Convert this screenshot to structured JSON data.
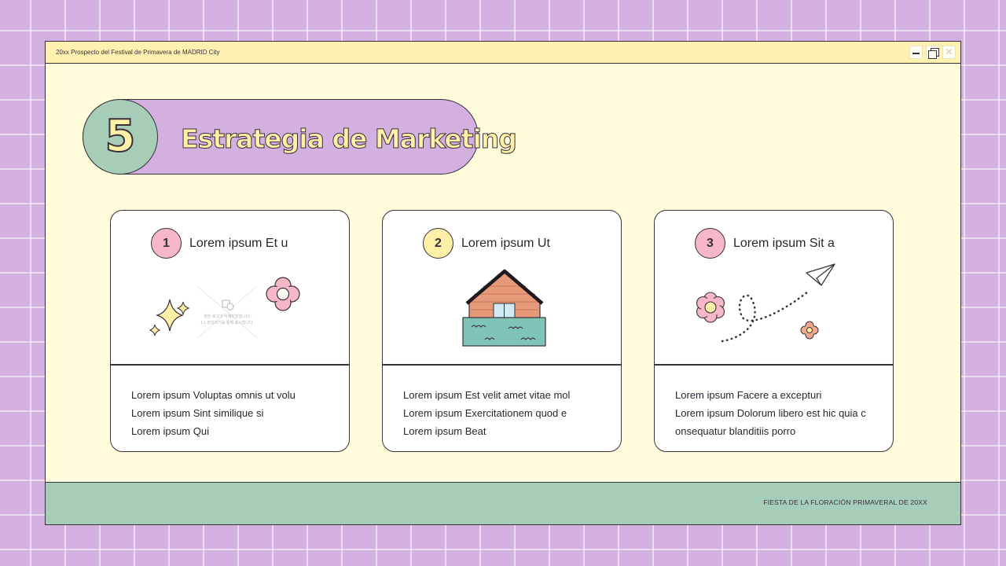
{
  "window": {
    "title": "20xx Prospecto del Festival de Primavera de MADRID City",
    "controls": [
      "minimize-icon",
      "restore-icon",
      "close-icon"
    ],
    "close_glyph": "✕"
  },
  "heading": {
    "number": "5",
    "title": "Estrategia de Marketing"
  },
  "cards": [
    {
      "badge": "1",
      "title": "Lorem ipsum Et u",
      "icons": [
        "sparkle-icon",
        "image-placeholder-icon",
        "flower-icon"
      ],
      "placeholder_line1": "편한 로고가 삭제되었습니다.",
      "placeholder_line2": "1:1 편의리기를 통해 표시합니다.",
      "lines": [
        "Lorem ipsum Voluptas omnis ut volu",
        "Lorem ipsum Sint similique si",
        "Lorem ipsum Qui"
      ]
    },
    {
      "badge": "2",
      "title": "Lorem ipsum Ut",
      "icons": [
        "house-icon"
      ],
      "lines": [
        "Lorem ipsum Est velit amet vitae mol",
        "Lorem ipsum Exercitationem quod e",
        "Lorem ipsum Beat"
      ]
    },
    {
      "badge": "3",
      "title": "Lorem ipsum Sit a",
      "icons": [
        "flower-icon",
        "paper-plane-icon",
        "flower-icon"
      ],
      "lines": [
        "Lorem ipsum Facere a excepturi",
        "Lorem ipsum Dolorum libero est hic quia c",
        "onsequatur blanditiis porro"
      ]
    }
  ],
  "footer": {
    "text": "FIESTA DE LA FLORACIÓN PRIMAVERAL DE 20XX"
  },
  "colors": {
    "background": "#d3b0e0",
    "grid_lines": "#ffffff",
    "window_body": "#fffcdc",
    "title_bar": "#fff2b0",
    "number_circle": "#a6cdb8",
    "footer": "#a6cdb8",
    "badge_pink": "#f6b7c6",
    "badge_yellow": "#fff0a8",
    "outline": "#3a2f3a"
  }
}
